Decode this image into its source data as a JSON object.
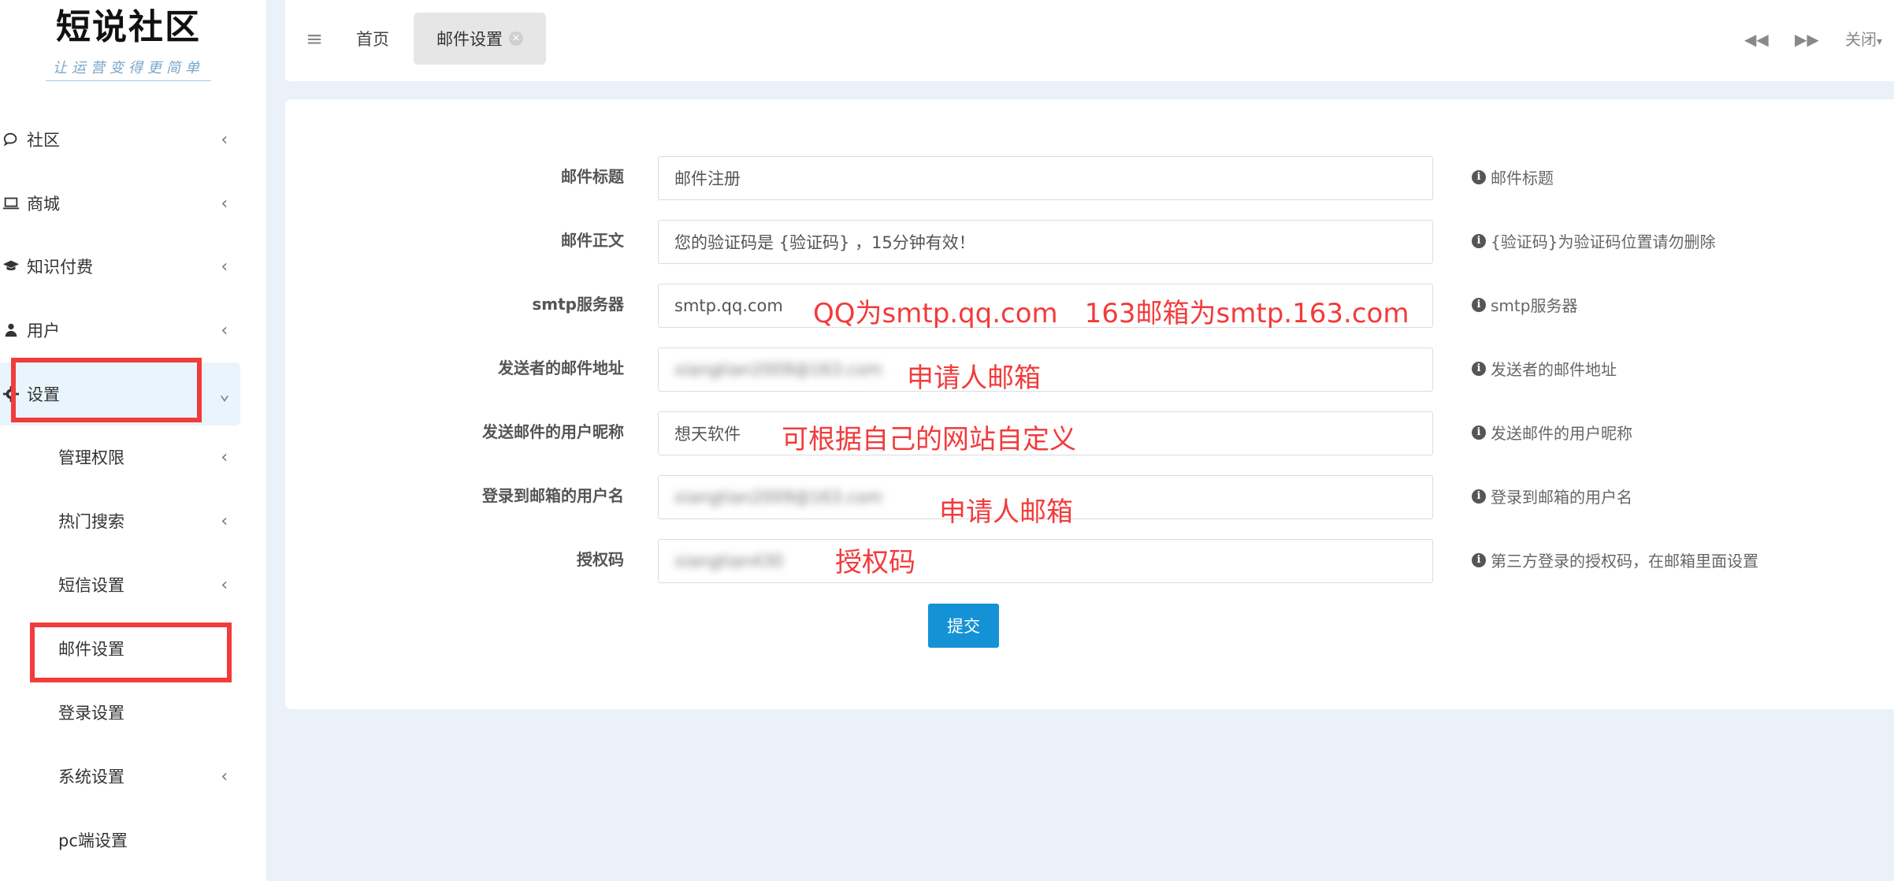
{
  "logo": {
    "title": "短说社区",
    "slogan": "让运营变得更简单"
  },
  "sidebar": {
    "items": [
      {
        "label": "社区",
        "icon": "chat-icon"
      },
      {
        "label": "商城",
        "icon": "laptop-icon"
      },
      {
        "label": "知识付费",
        "icon": "graduation-cap-icon"
      },
      {
        "label": "用户",
        "icon": "user-icon"
      },
      {
        "label": "设置",
        "icon": "gear-icon"
      }
    ],
    "sub_items": [
      {
        "label": "管理权限"
      },
      {
        "label": "热门搜索"
      },
      {
        "label": "短信设置"
      },
      {
        "label": "邮件设置"
      },
      {
        "label": "登录设置"
      },
      {
        "label": "系统设置"
      },
      {
        "label": "pc端设置"
      }
    ]
  },
  "topbar": {
    "home_tab": "首页",
    "active_tab": "邮件设置",
    "close_label": "关闭"
  },
  "form": {
    "fields": [
      {
        "label": "邮件标题",
        "value": "邮件注册",
        "help": "邮件标题"
      },
      {
        "label": "邮件正文",
        "value": "您的验证码是 {验证码} ，15分钟有效！",
        "help": "{验证码}为验证码位置请勿删除"
      },
      {
        "label": "smtp服务器",
        "value": "smtp.qq.com",
        "help": "smtp服务器"
      },
      {
        "label": "发送者的邮件地址",
        "value": "xiangtian2009@163.com",
        "help": "发送者的邮件地址"
      },
      {
        "label": "发送邮件的用户昵称",
        "value": "想天软件",
        "help": "发送邮件的用户昵称"
      },
      {
        "label": "登录到邮箱的用户名",
        "value": "xiangtian2009@163.com",
        "help": "登录到邮箱的用户名"
      },
      {
        "label": "授权码",
        "value": "xiangtian430",
        "help": "第三方登录的授权码，在邮箱里面设置"
      }
    ],
    "submit_label": "提交"
  },
  "annotations": {
    "smtp": "QQ为smtp.qq.com　163邮箱为smtp.163.com",
    "sender": "申请人邮箱",
    "nickname": "可根据自己的网站自定义",
    "username": "申请人邮箱",
    "authcode": "授权码"
  },
  "colors": {
    "accent": "#1592d6",
    "annotation_red": "#f23b3b",
    "page_bg": "#eaf1f8",
    "active_nav_bg": "#e9f4fc"
  }
}
